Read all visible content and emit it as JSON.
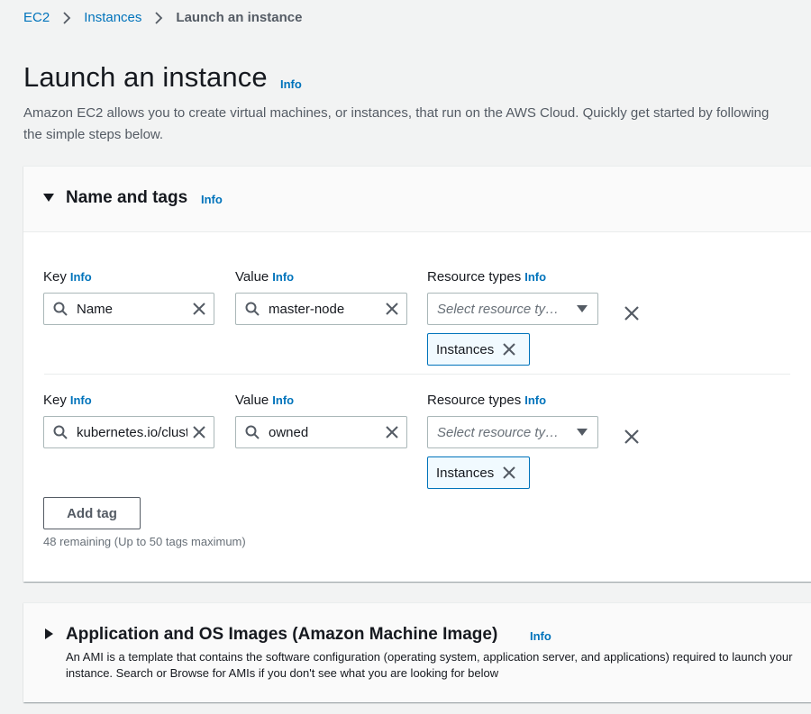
{
  "breadcrumb": {
    "items": [
      "EC2",
      "Instances"
    ],
    "current": "Launch an instance"
  },
  "header": {
    "title": "Launch an instance",
    "info": "Info",
    "description": "Amazon EC2 allows you to create virtual machines, or instances, that run on the AWS Cloud. Quickly get started by following the simple steps below."
  },
  "name_and_tags": {
    "title": "Name and tags",
    "info": "Info",
    "labels": {
      "key": "Key",
      "value": "Value",
      "resource_types": "Resource types",
      "info": "Info"
    },
    "tags": [
      {
        "key": "Name",
        "value": "master-node",
        "resource_placeholder": "Select resource ty…",
        "token": "Instances"
      },
      {
        "key": "kubernetes.io/cluster/kubernetes",
        "value": "owned",
        "resource_placeholder": "Select resource ty…",
        "token": "Instances"
      }
    ],
    "add_tag_label": "Add tag",
    "remaining_text": "48 remaining (Up to 50 tags maximum)"
  },
  "ami_section": {
    "title": "Application and OS Images (Amazon Machine Image)",
    "info": "Info",
    "description": "An AMI is a template that contains the software configuration (operating system, application server, and applications) required to launch your instance. Search or Browse for AMIs if you don't see what you are looking for below"
  },
  "colors": {
    "link": "#0073bb",
    "page_bg": "#f2f3f3",
    "token_bg": "#f1faff"
  }
}
